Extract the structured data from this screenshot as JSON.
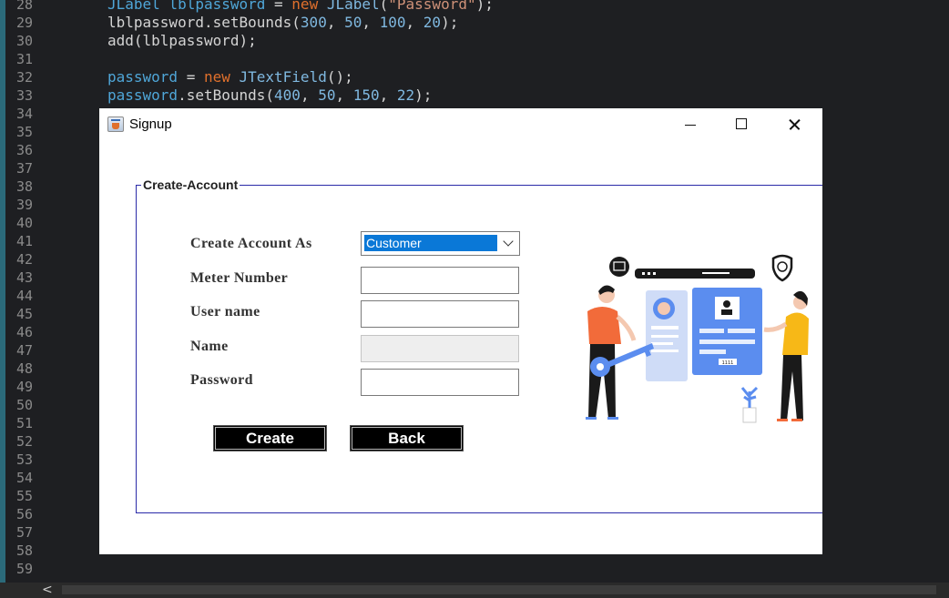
{
  "editor": {
    "lines": [
      {
        "n": "28",
        "code": [
          [
            "v",
            "JLabel lblpassword "
          ],
          [
            "p",
            "= "
          ],
          [
            "k",
            "new "
          ],
          [
            "n",
            "JLabel"
          ],
          [
            "p",
            "("
          ],
          [
            "s",
            "\"Password\""
          ],
          [
            "p",
            ");"
          ]
        ]
      },
      {
        "n": "29",
        "code": [
          [
            "p",
            "lblpassword.setBounds("
          ],
          [
            "n",
            "300"
          ],
          [
            "p",
            ", "
          ],
          [
            "n",
            "50"
          ],
          [
            "p",
            ", "
          ],
          [
            "n",
            "100"
          ],
          [
            "p",
            ", "
          ],
          [
            "n",
            "20"
          ],
          [
            "p",
            ");"
          ]
        ]
      },
      {
        "n": "30",
        "code": [
          [
            "p",
            "add(lblpassword);"
          ]
        ]
      },
      {
        "n": "31",
        "code": []
      },
      {
        "n": "32",
        "code": [
          [
            "v",
            "password "
          ],
          [
            "p",
            "= "
          ],
          [
            "k",
            "new "
          ],
          [
            "n",
            "JTextField"
          ],
          [
            "p",
            "();"
          ]
        ]
      },
      {
        "n": "33",
        "code": [
          [
            "v",
            "password"
          ],
          [
            "p",
            ".setBounds("
          ],
          [
            "n",
            "400"
          ],
          [
            "p",
            ", "
          ],
          [
            "n",
            "50"
          ],
          [
            "p",
            ", "
          ],
          [
            "n",
            "150"
          ],
          [
            "p",
            ", "
          ],
          [
            "n",
            "22"
          ],
          [
            "p",
            ");"
          ]
        ]
      },
      {
        "n": "34",
        "code": []
      },
      {
        "n": "35",
        "code": []
      },
      {
        "n": "36",
        "code": []
      },
      {
        "n": "37",
        "code": []
      },
      {
        "n": "38",
        "code": []
      },
      {
        "n": "39",
        "code": []
      },
      {
        "n": "40",
        "code": []
      },
      {
        "n": "41",
        "code": []
      },
      {
        "n": "42",
        "code": []
      },
      {
        "n": "43",
        "code": []
      },
      {
        "n": "44",
        "code": []
      },
      {
        "n": "45",
        "code": []
      },
      {
        "n": "46",
        "code": []
      },
      {
        "n": "47",
        "code": []
      },
      {
        "n": "48",
        "code": []
      },
      {
        "n": "49",
        "code": []
      },
      {
        "n": "50",
        "code": []
      },
      {
        "n": "51",
        "code": []
      },
      {
        "n": "52",
        "code": []
      },
      {
        "n": "53",
        "code": []
      },
      {
        "n": "54",
        "code": []
      },
      {
        "n": "55",
        "code": []
      },
      {
        "n": "56",
        "code": []
      },
      {
        "n": "57",
        "code": []
      },
      {
        "n": "58",
        "code": []
      },
      {
        "n": "59",
        "code": []
      }
    ],
    "scroll_left_glyph": "<"
  },
  "window": {
    "title": "Signup",
    "group_title": "Create-Account",
    "form": {
      "account_type_label": "Create Account As",
      "account_type_value": "Customer",
      "meter_label": "Meter Number",
      "meter_value": "",
      "username_label": "User name",
      "username_value": "",
      "name_label": "Name",
      "name_value": "",
      "password_label": "Password",
      "password_value": ""
    },
    "buttons": {
      "create": "Create",
      "back": "Back"
    },
    "illustration_text": "1111",
    "colors": {
      "accent_blue": "#0a78d7",
      "group_border": "#2a2aa8",
      "illustration_blue": "#5b8def",
      "illustration_orange": "#f26b3a",
      "illustration_yellow": "#f7b817"
    }
  }
}
